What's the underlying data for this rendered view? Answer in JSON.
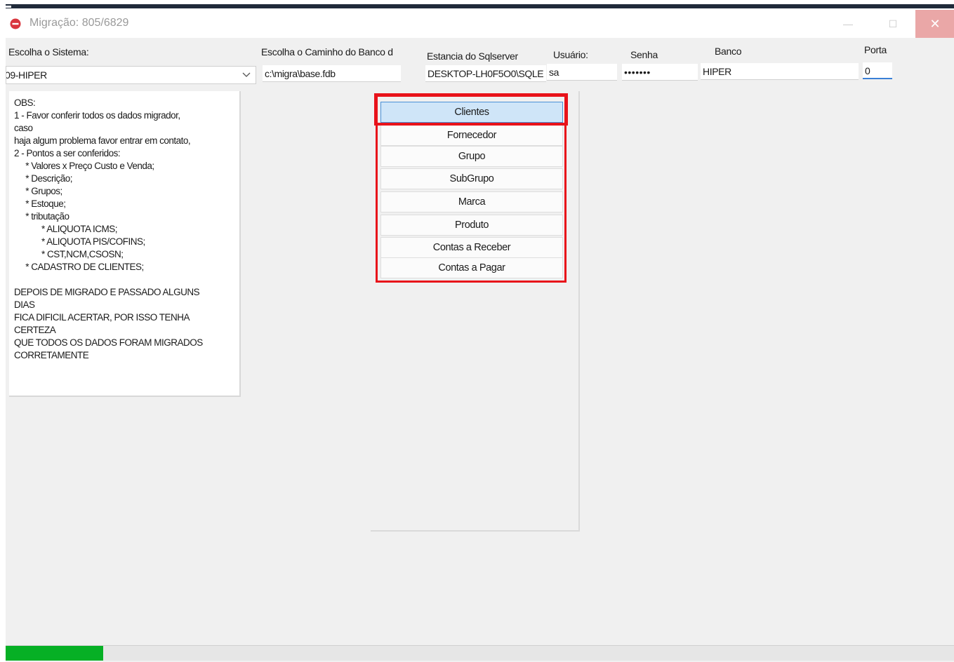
{
  "window": {
    "title": "Migração: 805/6829",
    "close_glyph": "✕",
    "minimize_glyph": "—",
    "maximize_glyph": "☐"
  },
  "form": {
    "sistema": {
      "label": "Escolha o Sistema:",
      "value": "09-HIPER"
    },
    "caminho": {
      "label": "Escolha o Caminho do Banco d",
      "value": "c:\\migra\\base.fdb"
    },
    "estancia": {
      "label": "Estancia do Sqlserver",
      "value": "DESKTOP-LH0F5O0\\SQLE"
    },
    "usuario": {
      "label": "Usuário:",
      "value": "sa"
    },
    "senha": {
      "label": "Senha",
      "value": "•••••••"
    },
    "banco": {
      "label": "Banco",
      "value": "HIPER"
    },
    "porta": {
      "label": "Porta",
      "value": "0"
    }
  },
  "obs": {
    "lines": [
      "OBS:",
      "1 - Favor conferir todos os dados migrador,",
      "caso",
      "haja algum problema favor entrar em contato,",
      "2 - Pontos a ser conferidos:",
      "     * Valores x Preço Custo e Venda;",
      "     * Descrição;",
      "     * Grupos;",
      "     * Estoque;",
      "     * tributação",
      "            * ALIQUOTA ICMS;",
      "            * ALIQUOTA PIS/COFINS;",
      "            * CST,NCM,CSOSN;",
      "     * CADASTRO DE CLIENTES;",
      "",
      "DEPOIS DE MIGRADO E PASSADO ALGUNS",
      "DIAS",
      "FICA DIFICIL ACERTAR, POR ISSO TENHA",
      "CERTEZA",
      "QUE TODOS OS DADOS FORAM MIGRADOS",
      "CORRETAMENTE"
    ]
  },
  "buttons": [
    {
      "label": "Clientes",
      "active": true
    },
    {
      "label": "Fornecedor",
      "active": false
    },
    {
      "label": "Grupo",
      "active": false
    },
    {
      "label": "SubGrupo",
      "active": false
    },
    {
      "label": "Marca",
      "active": false
    },
    {
      "label": "Produto",
      "active": false
    },
    {
      "label": "Contas a Receber",
      "active": false
    },
    {
      "label": "Contas a Pagar",
      "active": false
    }
  ],
  "progress": {
    "fraction": 0.103
  },
  "colors": {
    "highlight": "#e8121a",
    "progress": "#06b025",
    "active_button": "#cfe5f8"
  }
}
